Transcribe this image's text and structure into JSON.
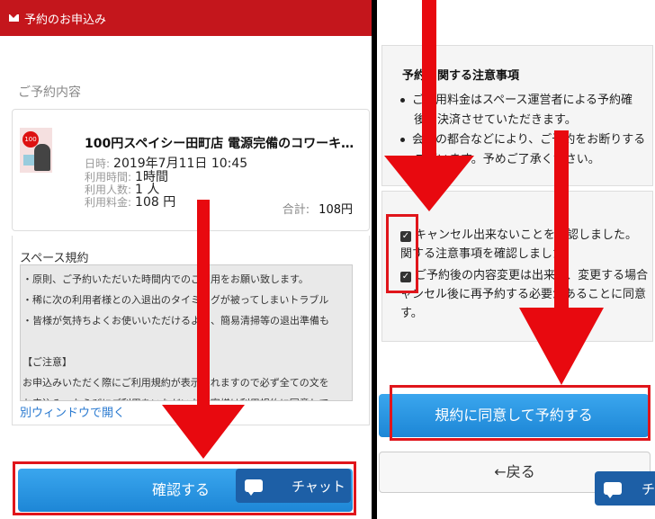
{
  "left": {
    "header_title": "予約のお申込み",
    "section_title": "ご予約内容",
    "reservation": {
      "shop_name": "100円スペイシー田町店 電源完備のコワーキ…",
      "date_label": "日時:",
      "date_value": "2019年7月11日 10:45",
      "duration_label": "利用時間:",
      "duration_value": "1時間",
      "people_label": "利用人数:",
      "people_value": "1 人",
      "fee_label": "利用料金:",
      "fee_value": "108 円",
      "total_label": "合計:",
      "total_value": "108円",
      "thumb_logo": "100"
    },
    "rules": {
      "title": "スペース規約",
      "lines": [
        "・原則、ご予約いただいた時間内でのご利用をお願い致します。",
        "・稀に次の利用者様との入退出のタイミングが被ってしまいトラブル",
        "・皆様が気持ちよくお使いいただけるよう、簡易清掃等の退出準備も",
        "",
        "【ご注意】",
        "お申込みいただく際にご利用規約が表示されますので必ず全ての文を",
        "お申込み、ならびにご利用をいただいたお客様は利用規約に同意して"
      ],
      "link": "別ウィンドウで開く"
    },
    "confirm_button": "確認する",
    "chat_label": "チャット"
  },
  "right": {
    "notes_title": "予約に関する注意事項",
    "notes": [
      "ご利用料金はスペース運営者による予約確",
      "後、決済させていただきます。",
      "会場の都合などにより、ご予約をお断りする",
      "ございます。予めご了承ください。"
    ],
    "agree_1a": "キャンセル出来ないことを確認しました。",
    "agree_1b": "関する注意事項を確認しました。",
    "agree_2a": "ご予約後の内容変更は出来ず、変更する場合",
    "agree_2b": "ャンセル後に再予約する必要があることに同意",
    "agree_2c": "す。",
    "reserve_button": "規約に同意して予約する",
    "back_button": "←戻る",
    "chat_label": "チ"
  },
  "colors": {
    "header_red": "#c4161c",
    "button_blue": "#1d86d6",
    "annotation_red": "#e8090f"
  }
}
